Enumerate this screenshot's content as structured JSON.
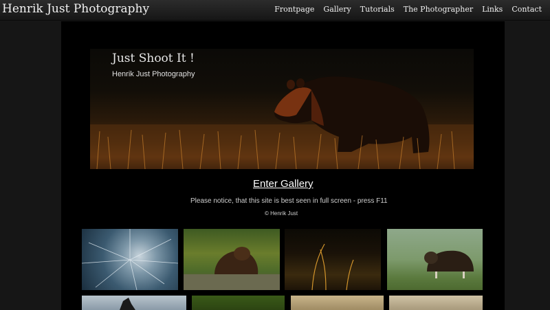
{
  "navbar": {
    "brand": "Henrik Just Photography",
    "links": [
      {
        "label": "Frontpage"
      },
      {
        "label": "Gallery"
      },
      {
        "label": "Tutorials"
      },
      {
        "label": "The Photographer"
      },
      {
        "label": "Links"
      },
      {
        "label": "Contact"
      }
    ]
  },
  "hero": {
    "title": "Just Shoot It !",
    "subtitle": "Henrik Just Photography"
  },
  "main": {
    "enter_gallery": "Enter Gallery",
    "notice": "Please notice, that this site is best seen in full screen - press F11",
    "copyright": "© Henrik Just"
  },
  "thumbnails": [
    {
      "subject": "dandelion-seeds"
    },
    {
      "subject": "brown-bear-in-water"
    },
    {
      "subject": "grass-at-sunset"
    },
    {
      "subject": "muskox"
    },
    {
      "subject": "bird-silhouette"
    },
    {
      "subject": "green-foliage"
    },
    {
      "subject": "sand-dune"
    },
    {
      "subject": "sand-dune"
    }
  ],
  "colors": {
    "background": "#161616",
    "panel": "#000000",
    "text": "#f0f0f0"
  }
}
